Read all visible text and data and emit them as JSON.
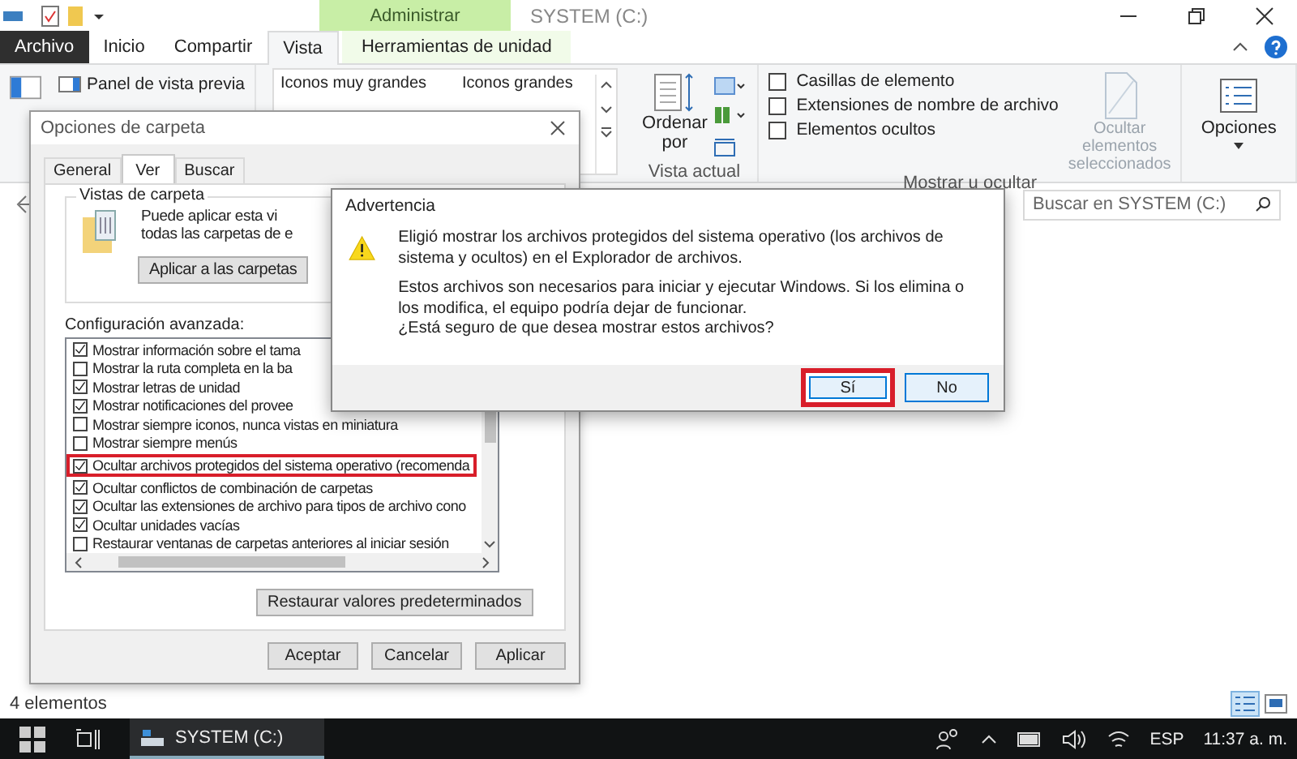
{
  "title_bar": {
    "context_tab": "Administrar",
    "title": "SYSTEM (C:)"
  },
  "ribbon_tabs": [
    {
      "label": "Archivo",
      "kind": "file",
      "selected": false
    },
    {
      "label": "Inicio",
      "kind": "tab",
      "selected": false
    },
    {
      "label": "Compartir",
      "kind": "tab",
      "selected": false
    },
    {
      "label": "Vista",
      "kind": "tab",
      "selected": true
    },
    {
      "label": "Herramientas de unidad",
      "kind": "context",
      "selected": false
    }
  ],
  "ribbon": {
    "preview_pane": "Panel de vista previa",
    "layouts": [
      "Iconos muy grandes",
      "Iconos grandes"
    ],
    "sort_button": "Ordenar por",
    "current_view_label": "Vista actual",
    "show_hide": [
      {
        "label": "Casillas de elemento",
        "checked": false
      },
      {
        "label": "Extensiones de nombre de archivo",
        "checked": false
      },
      {
        "label": "Elementos ocultos",
        "checked": false
      }
    ],
    "hide_selected": {
      "label": "Ocultar elementos seleccionados",
      "disabled": true
    },
    "show_hide_label": "Mostrar u ocultar",
    "options": "Opciones"
  },
  "search": {
    "placeholder": "Buscar en SYSTEM (C:)"
  },
  "status_bar": "4 elementos",
  "folder_options": {
    "title": "Opciones de carpeta",
    "tabs": [
      {
        "label": "General",
        "selected": false
      },
      {
        "label": "Ver",
        "selected": true
      },
      {
        "label": "Buscar",
        "selected": false
      }
    ],
    "folder_views": {
      "title": "Vistas de carpeta",
      "text": [
        "Puede aplicar esta vi",
        "todas las carpetas de e"
      ],
      "button": "Aplicar a las carpetas"
    },
    "advanced_label": "Configuración avanzada:",
    "advanced_settings": [
      {
        "label": "Mostrar información sobre el tama",
        "checked": true,
        "highlighted": false
      },
      {
        "label": "Mostrar la ruta completa en la ba",
        "checked": false,
        "highlighted": false
      },
      {
        "label": "Mostrar letras de unidad",
        "checked": true,
        "highlighted": false
      },
      {
        "label": "Mostrar notificaciones del provee",
        "checked": true,
        "highlighted": false
      },
      {
        "label": "Mostrar siempre iconos, nunca vistas en miniatura",
        "checked": false,
        "highlighted": false
      },
      {
        "label": "Mostrar siempre menús",
        "checked": false,
        "highlighted": false
      },
      {
        "label": "Ocultar archivos protegidos del sistema operativo (recomenda",
        "checked": true,
        "highlighted": true
      },
      {
        "label": "Ocultar conflictos de combinación de carpetas",
        "checked": true,
        "highlighted": false
      },
      {
        "label": "Ocultar las extensiones de archivo para tipos de archivo cono",
        "checked": true,
        "highlighted": false
      },
      {
        "label": "Ocultar unidades vacías",
        "checked": true,
        "highlighted": false
      },
      {
        "label": "Restaurar ventanas de carpetas anteriores al iniciar sesión",
        "checked": false,
        "highlighted": false
      }
    ],
    "restore_button": "Restaurar valores predeterminados",
    "buttons": [
      "Aceptar",
      "Cancelar",
      "Aplicar"
    ]
  },
  "warning": {
    "title": "Advertencia",
    "paragraphs": [
      [
        "Eligió mostrar los archivos protegidos del sistema operativo (los archivos de sistema y ocultos) en el Explorador de archivos."
      ],
      [
        "Estos archivos son necesarios para iniciar y ejecutar Windows. Si los elimina o los modifica, el equipo podría dejar de funcionar.",
        "¿Está seguro de que desea mostrar estos archivos?"
      ]
    ],
    "buttons": [
      {
        "label": "Sí",
        "highlighted": true
      },
      {
        "label": "No",
        "highlighted": false
      }
    ]
  },
  "taskbar": {
    "app": "SYSTEM (C:)",
    "language": "ESP",
    "clock": "11:37 a. m."
  }
}
